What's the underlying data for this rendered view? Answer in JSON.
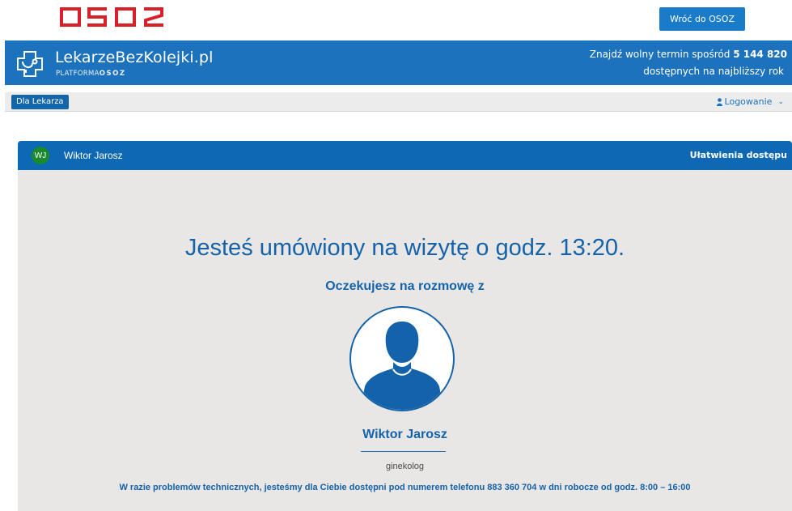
{
  "top": {
    "logo_text": "OSOZ",
    "back_button": "Wróć do OSOZ"
  },
  "header": {
    "brand_name": "LekarzeBezKolejki.pl",
    "brand_sub_prefix": "PLATFORMA",
    "brand_sub_logo": "OSOZ",
    "promo_prefix": "Znajdź wolny termin spośród",
    "promo_count": "5 144 820",
    "promo_line2": "dostępnych na najbliższy rok"
  },
  "nav": {
    "for_doctor": "Dla Lekarza",
    "login": "Logowanie"
  },
  "panel": {
    "avatar_initials": "WJ",
    "patient_name": "Wiktor Jarosz",
    "accessibility": "Ułatwienia dostępu",
    "appointment_text": "Jesteś umówiony na wizytę o godz. 13:20.",
    "waiting_text": "Oczekujesz na rozmowę z",
    "doctor_name": "Wiktor Jarosz",
    "specialty": "ginekolog",
    "support_text": "W razie problemów technicznych, jesteśmy dla Ciebie dostępni pod numerem telefonu 883 360 704 w dni robocze od godz. 8:00 – 16:00"
  },
  "colors": {
    "brand_blue": "#1d72be",
    "panel_blue": "#0e68b3",
    "osoz_red": "#d8202a",
    "avatar_green": "#1b8a2f"
  },
  "icons": [
    "osoz-logo",
    "brand-stethoscope-icon",
    "user-icon",
    "chevron-down-icon",
    "doctor-avatar-icon"
  ]
}
